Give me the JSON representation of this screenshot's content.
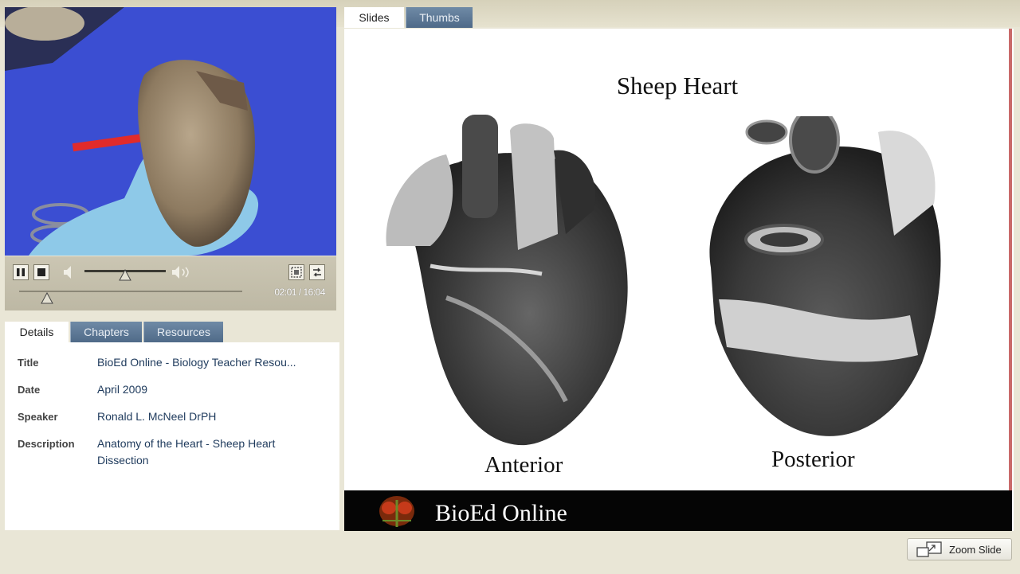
{
  "video": {
    "current_time": "02:01",
    "separator": "/",
    "duration": "16:04",
    "progress_fraction": 0.126,
    "volume_fraction": 0.5
  },
  "info_tabs": [
    {
      "label": "Details",
      "active": true
    },
    {
      "label": "Chapters",
      "active": false
    },
    {
      "label": "Resources",
      "active": false
    }
  ],
  "details": {
    "title_label": "Title",
    "title_value": "BioEd Online - Biology Teacher Resou...",
    "date_label": "Date",
    "date_value": "April 2009",
    "speaker_label": "Speaker",
    "speaker_value": "Ronald L. McNeel DrPH",
    "description_label": "Description",
    "description_value": "Anatomy of the Heart - Sheep Heart Dissection"
  },
  "slide_tabs": [
    {
      "label": "Slides",
      "active": true
    },
    {
      "label": "Thumbs",
      "active": false
    }
  ],
  "slide": {
    "title": "Sheep Heart",
    "left_caption": "Anterior",
    "right_caption": "Posterior",
    "footer_brand": "BioEd Online"
  },
  "zoom_button": {
    "label": "Zoom Slide"
  },
  "colors": {
    "tab_inactive": "#5a7594",
    "video_background": "#3a4fd0",
    "footer_background": "#050505",
    "slide_accent_line": "#c96a6a"
  }
}
